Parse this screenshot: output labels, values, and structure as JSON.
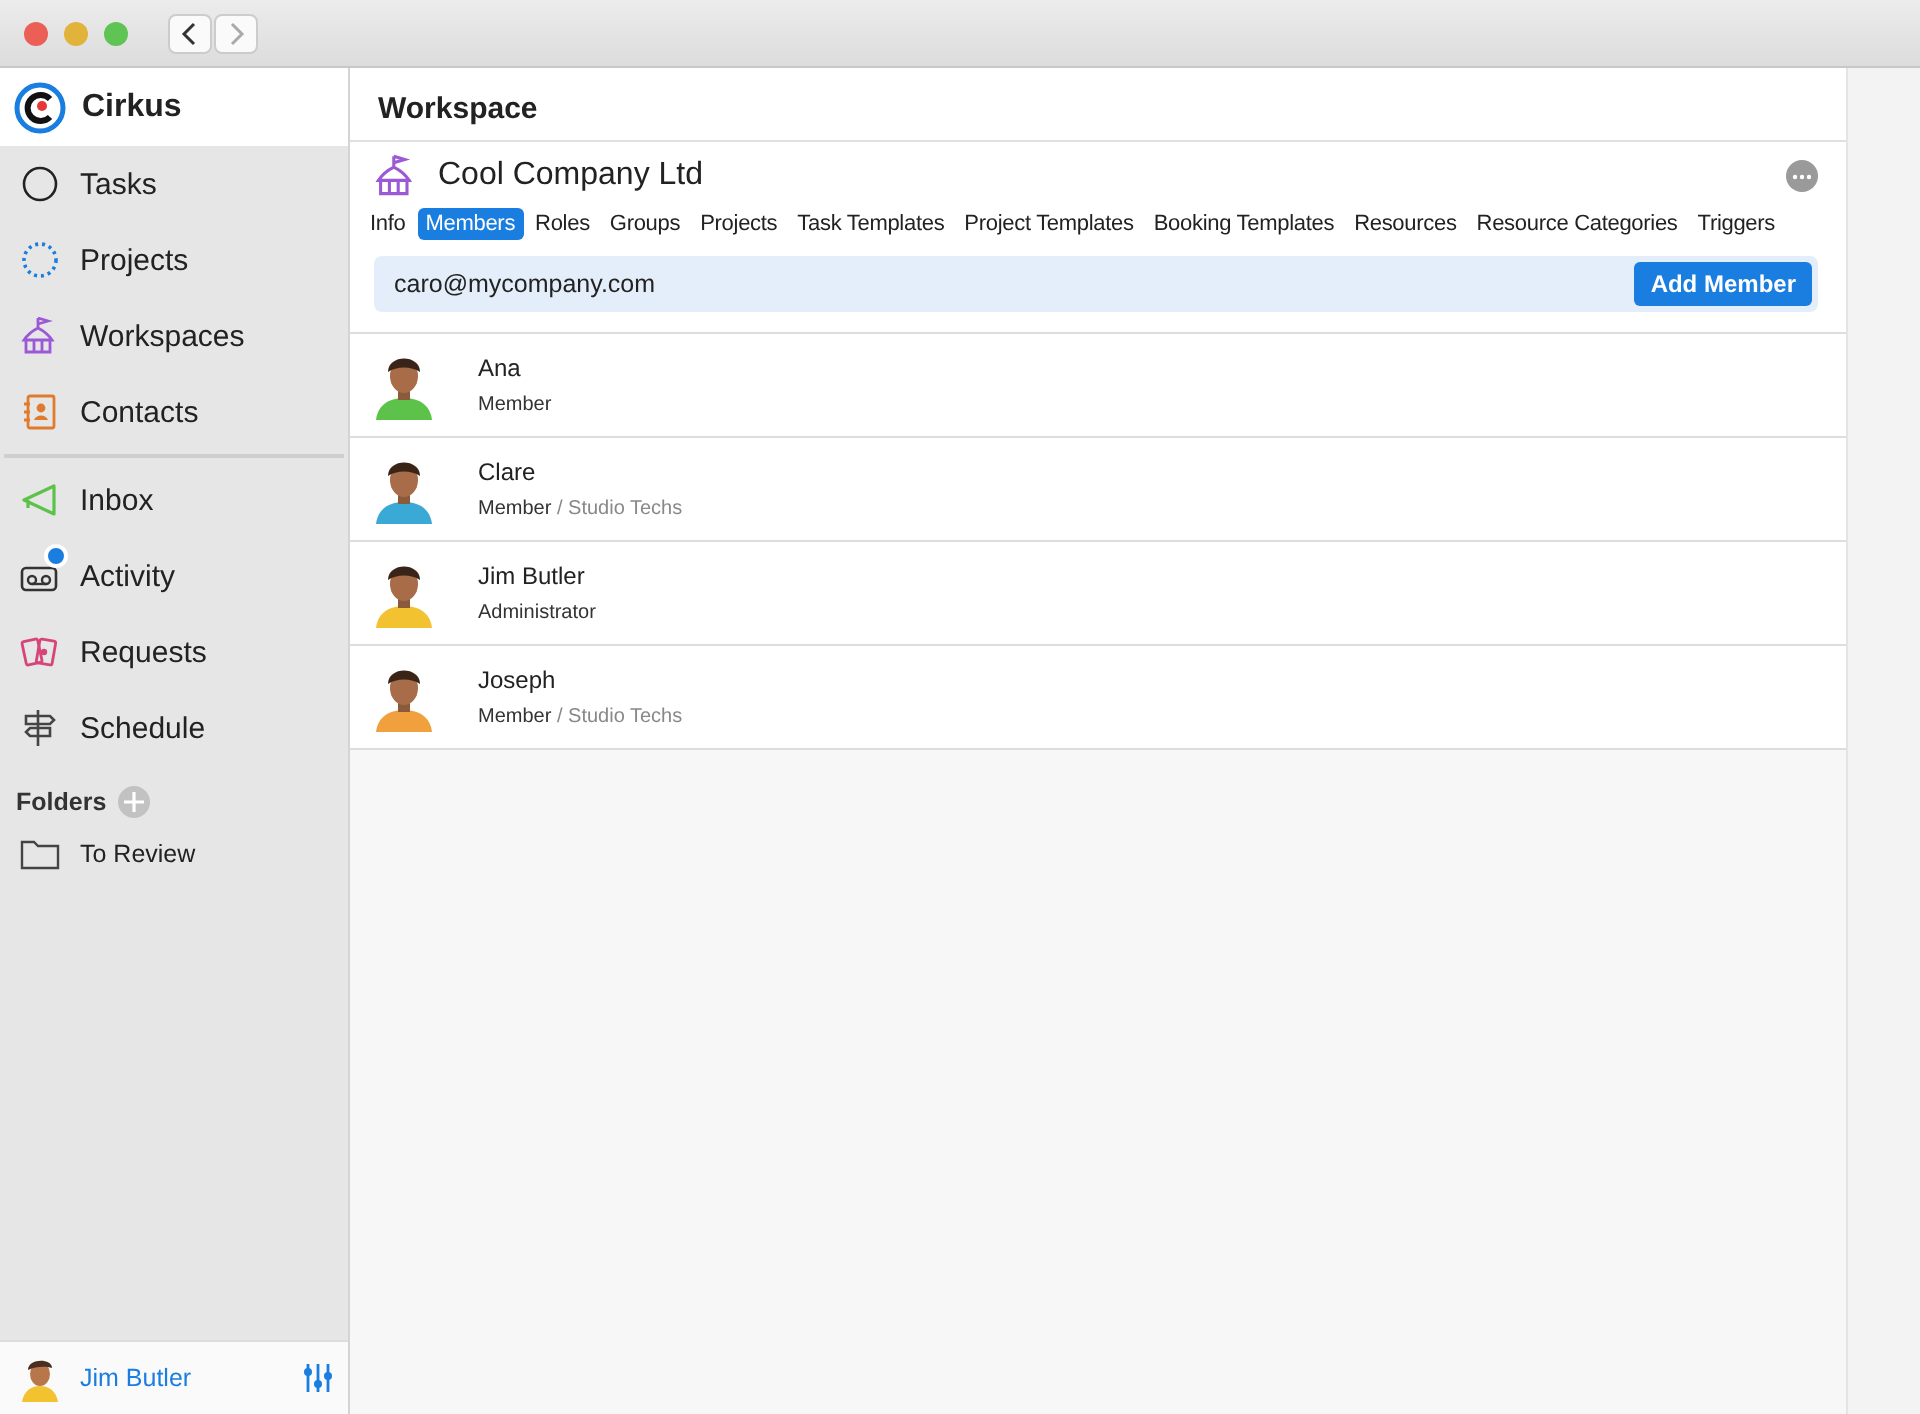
{
  "app": {
    "name": "Cirkus"
  },
  "nav": [
    {
      "kind": "tasks",
      "label": "Tasks",
      "badge": false
    },
    {
      "kind": "projects",
      "label": "Projects",
      "badge": false
    },
    {
      "kind": "workspaces",
      "label": "Workspaces",
      "badge": false
    },
    {
      "kind": "contacts",
      "label": "Contacts",
      "badge": false
    },
    {
      "kind": "inbox",
      "label": "Inbox",
      "badge": false
    },
    {
      "kind": "activity",
      "label": "Activity",
      "badge": true
    },
    {
      "kind": "requests",
      "label": "Requests",
      "badge": false
    },
    {
      "kind": "schedule",
      "label": "Schedule",
      "badge": false
    }
  ],
  "folders": {
    "title": "Folders",
    "items": [
      {
        "label": "To Review"
      }
    ]
  },
  "current_user": {
    "name": "Jim Butler",
    "color": "#f2c230"
  },
  "page": {
    "title": "Workspace"
  },
  "workspace": {
    "name": "Cool Company Ltd"
  },
  "tabs": [
    {
      "label": "Info",
      "selected": false
    },
    {
      "label": "Members",
      "selected": true
    },
    {
      "label": "Roles",
      "selected": false
    },
    {
      "label": "Groups",
      "selected": false
    },
    {
      "label": "Projects",
      "selected": false
    },
    {
      "label": "Task Templates",
      "selected": false
    },
    {
      "label": "Project Templates",
      "selected": false
    },
    {
      "label": "Booking Templates",
      "selected": false
    },
    {
      "label": "Resources",
      "selected": false
    },
    {
      "label": "Resource Categories",
      "selected": false
    },
    {
      "label": "Triggers",
      "selected": false
    }
  ],
  "invite": {
    "value": "caro@mycompany.com",
    "button": "Add Member"
  },
  "members": [
    {
      "name": "Ana",
      "role": "Member",
      "color": "#5cc24a"
    },
    {
      "name": "Clare",
      "role": "Member",
      "group": "/ Studio Techs",
      "color": "#3aa9d6"
    },
    {
      "name": "Jim Butler",
      "role": "Administrator",
      "color": "#f2c230"
    },
    {
      "name": "Joseph",
      "role": "Member",
      "group": "/ Studio Techs",
      "color": "#f0a03c"
    }
  ]
}
